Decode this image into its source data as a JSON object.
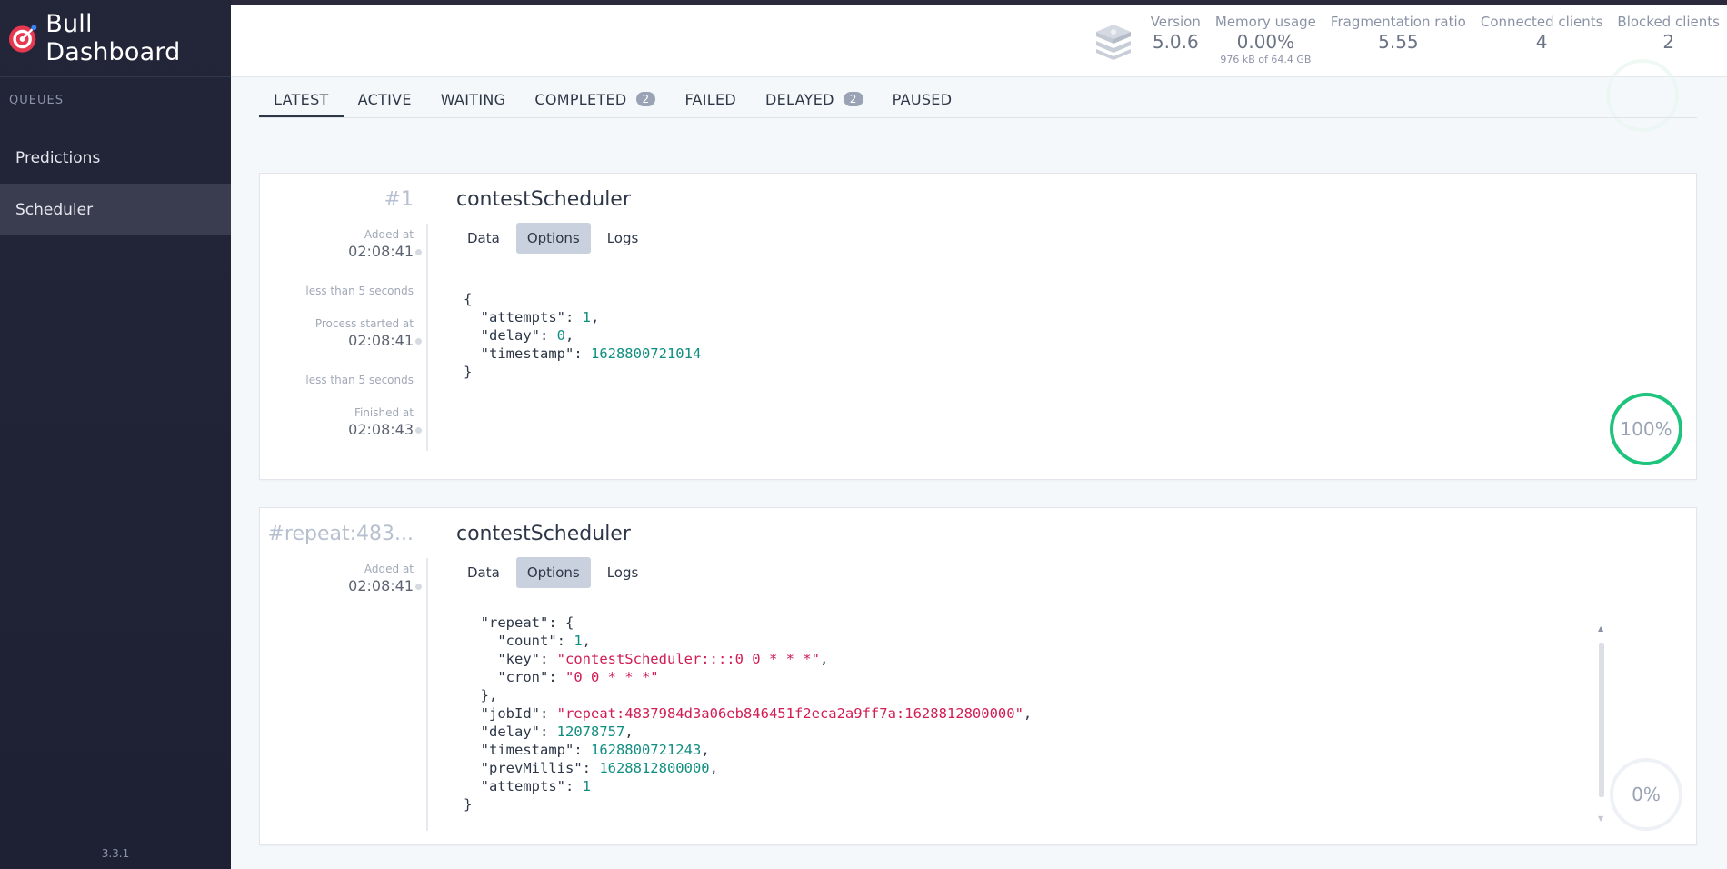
{
  "app": {
    "title": "Bull Dashboard",
    "version": "3.3.1"
  },
  "sidebar": {
    "section_label": "QUEUES",
    "items": [
      {
        "label": "Predictions",
        "active": false
      },
      {
        "label": "Scheduler",
        "active": true
      }
    ]
  },
  "stats": {
    "version": {
      "label": "Version",
      "value": "5.0.6"
    },
    "memory": {
      "label": "Memory usage",
      "value": "0.00%",
      "sub": "976 kB of 64.4 GB"
    },
    "fragmentation": {
      "label": "Fragmentation ratio",
      "value": "5.55"
    },
    "connected": {
      "label": "Connected clients",
      "value": "4"
    },
    "blocked": {
      "label": "Blocked clients",
      "value": "2"
    }
  },
  "tabs": [
    {
      "label": "LATEST",
      "active": true
    },
    {
      "label": "ACTIVE"
    },
    {
      "label": "WAITING"
    },
    {
      "label": "COMPLETED",
      "badge": "2"
    },
    {
      "label": "FAILED"
    },
    {
      "label": "DELAYED",
      "badge": "2"
    },
    {
      "label": "PAUSED"
    }
  ],
  "job_tabs": {
    "data": "Data",
    "options": "Options",
    "logs": "Logs"
  },
  "jobs": [
    {
      "id": "#1",
      "name": "contestScheduler",
      "added_label": "Added at",
      "added_time": "02:08:41",
      "gap1": "less than 5 seconds",
      "started_label": "Process started at",
      "started_time": "02:08:41",
      "gap2": "less than 5 seconds",
      "finished_label": "Finished at",
      "finished_time": "02:08:43",
      "progress": "100%",
      "options": {
        "attempts": "1",
        "delay": "0",
        "timestamp": "1628800721014"
      }
    },
    {
      "id": "#repeat:483...",
      "name": "contestScheduler",
      "added_label": "Added at",
      "added_time": "02:08:41",
      "progress": "0%",
      "options": {
        "repeat_count": "1",
        "repeat_key": "\"contestScheduler::::0 0 * * *\"",
        "repeat_cron": "\"0 0 * * *\"",
        "jobId": "\"repeat:4837984d3a06eb846451f2eca2a9ff7a:1628812800000\"",
        "delay": "12078757",
        "timestamp": "1628800721243",
        "prevMillis": "1628812800000",
        "attempts": "1"
      }
    }
  ],
  "colors": {
    "accent_progress": "#1fc47c",
    "sidebar_bg": "#232539",
    "json_number": "#0f8e80",
    "json_string": "#d21c54"
  }
}
